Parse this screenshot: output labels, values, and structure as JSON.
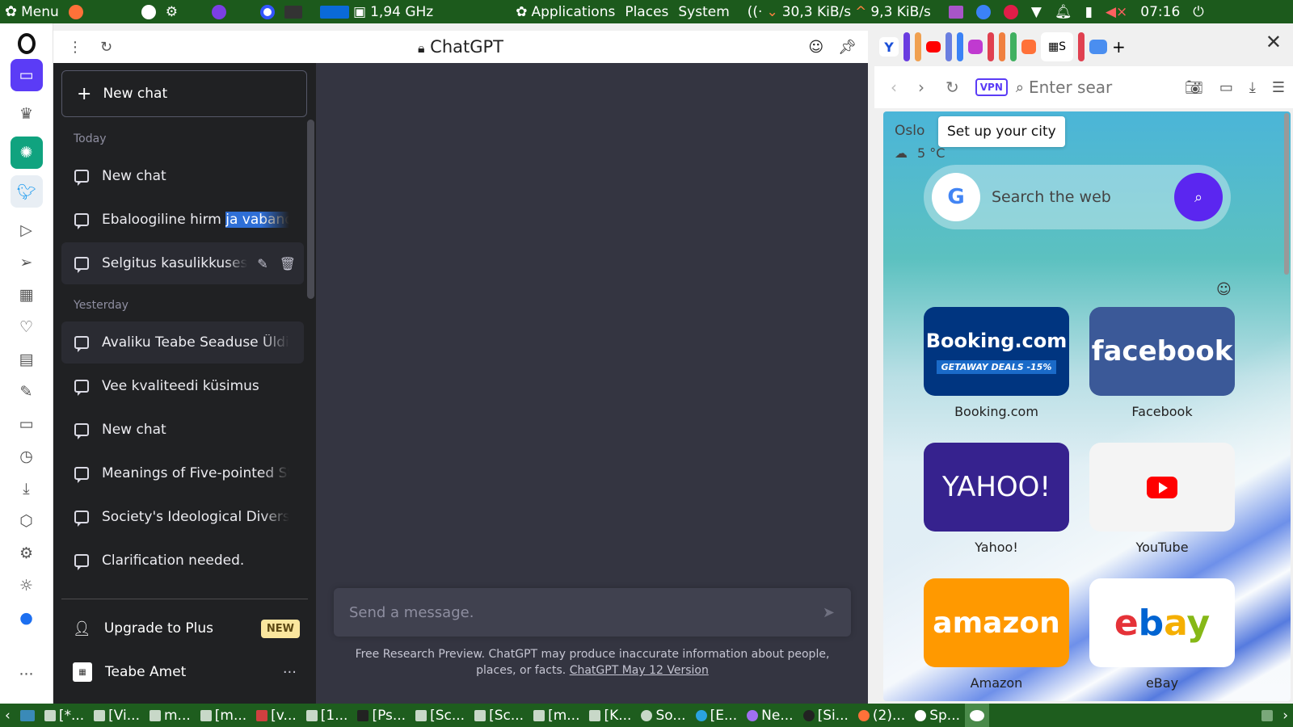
{
  "top_panel": {
    "menu_label": "Menu",
    "cpu_freq": "1,94 GHz",
    "applications": "Applications",
    "places": "Places",
    "system": "System",
    "net_down": "30,3 KiB/s",
    "net_up": "9,3 KiB/s",
    "clock": "07:16"
  },
  "panel_header": {
    "title": "ChatGPT"
  },
  "gpt_sidebar": {
    "new_chat": "New chat",
    "today_label": "Today",
    "yesterday_label": "Yesterday",
    "today_items": [
      {
        "label": "New chat"
      },
      {
        "label_plain": "Ebaloogiline hirm ",
        "label_selected": "ja vabandus"
      },
      {
        "label": "Selgitus kasulikkusest."
      }
    ],
    "yesterday_items": [
      {
        "label": "Avaliku Teabe Seaduse Üldise"
      },
      {
        "label": "Vee kvaliteedi küsimus"
      },
      {
        "label": "New chat"
      },
      {
        "label": "Meanings of Five-pointed Star"
      },
      {
        "label": "Society's Ideological Diversity"
      },
      {
        "label": "Clarification needed."
      }
    ],
    "upgrade": "Upgrade to Plus",
    "new_badge": "NEW",
    "user_name": "Teabe Amet"
  },
  "gpt_main": {
    "message_placeholder": "Send a message.",
    "disclaimer_text": "Free Research Preview. ChatGPT may produce inaccurate information about people, places, or facts.",
    "version_link": "ChatGPT May 12 Version"
  },
  "browser": {
    "tab_partial_label": "S",
    "address_placeholder": "Enter sear",
    "vpn_label": "VPN"
  },
  "speed_dial": {
    "city": "Oslo",
    "city_tooltip": "Set up your city",
    "temperature": "5 °C",
    "search_placeholder": "Search the web",
    "tiles": [
      {
        "name": "Booking.com",
        "logo": "Booking.com",
        "sub": "GETAWAY DEALS -15%"
      },
      {
        "name": "Facebook",
        "logo": "facebook"
      },
      {
        "name": "Yahoo!",
        "logo": "YAHOO!"
      },
      {
        "name": "YouTube"
      },
      {
        "name": "Amazon",
        "logo": "amazon"
      },
      {
        "name": "eBay"
      }
    ]
  },
  "taskbar": {
    "tasks": [
      "[*...",
      "[Vi...",
      "m...",
      "[m...",
      "[v...",
      "[1...",
      "[Ps...",
      "[Sc...",
      "[Sc...",
      "[m...",
      "[K...",
      "So...",
      "[E...",
      "Ne...",
      "[Si...",
      "(2)...",
      "Sp..."
    ]
  }
}
